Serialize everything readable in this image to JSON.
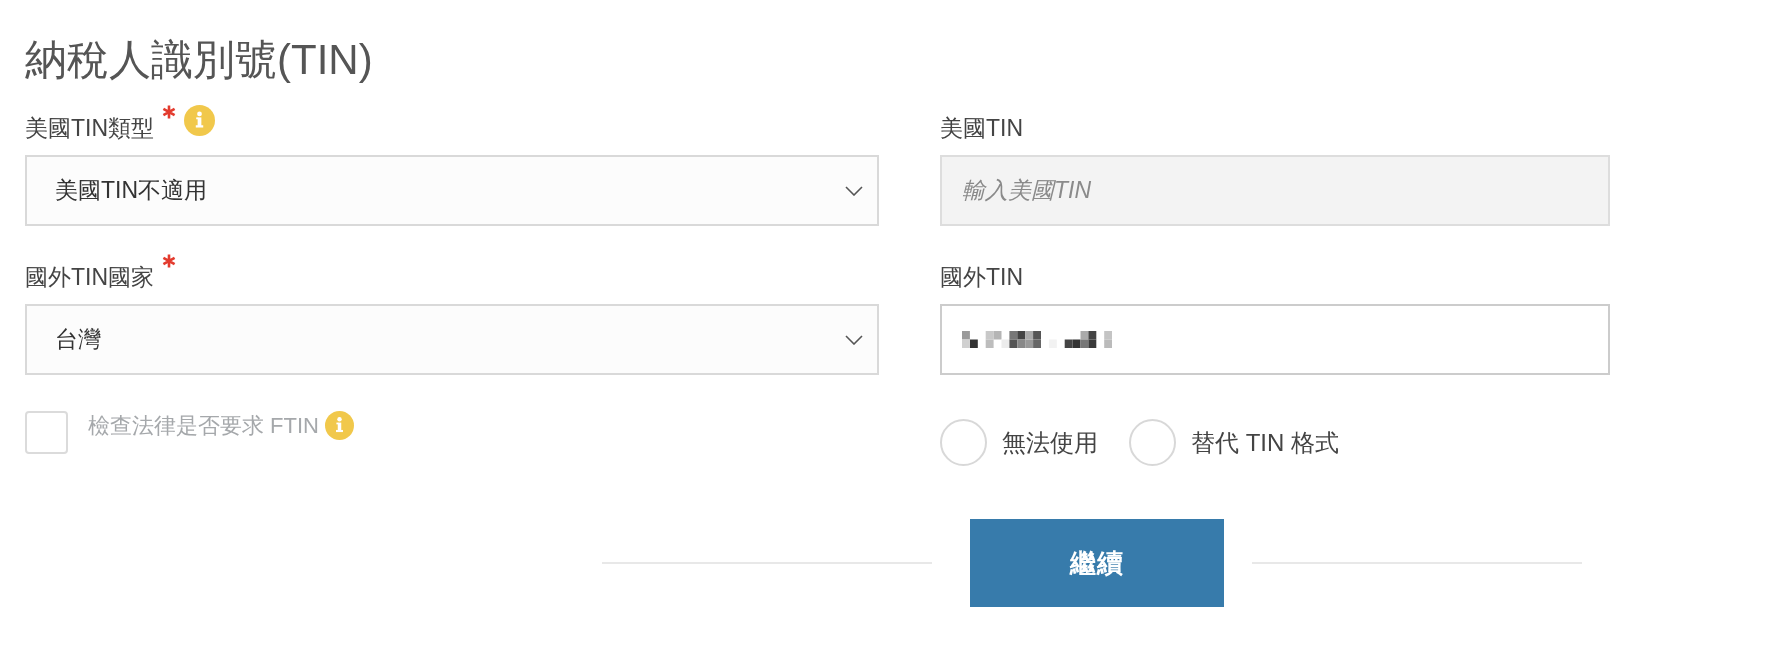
{
  "title": "納稅人識別號(TIN)",
  "fields": [
    {
      "kind": "select",
      "label": "美國TIN類型",
      "required": true,
      "help": true,
      "value": "美國TIN不適用"
    },
    {
      "kind": "input",
      "label": "美國TIN",
      "required": false,
      "help": false,
      "disabled": true,
      "redacted": false,
      "placeholder": "輸入美國TIN"
    },
    {
      "kind": "select",
      "label": "國外TIN國家",
      "required": true,
      "help": false,
      "value": "台灣"
    },
    {
      "kind": "input",
      "label": "國外TIN",
      "required": false,
      "help": false,
      "disabled": false,
      "redacted": true
    }
  ],
  "checkbox": {
    "label": "檢查法律是否要求 FTIN",
    "checked": false,
    "disabled": true,
    "help": true
  },
  "radios": [
    {
      "label": "無法使用",
      "selected": false
    },
    {
      "label": "替代 TIN 格式",
      "selected": false
    }
  ],
  "button": "繼續"
}
